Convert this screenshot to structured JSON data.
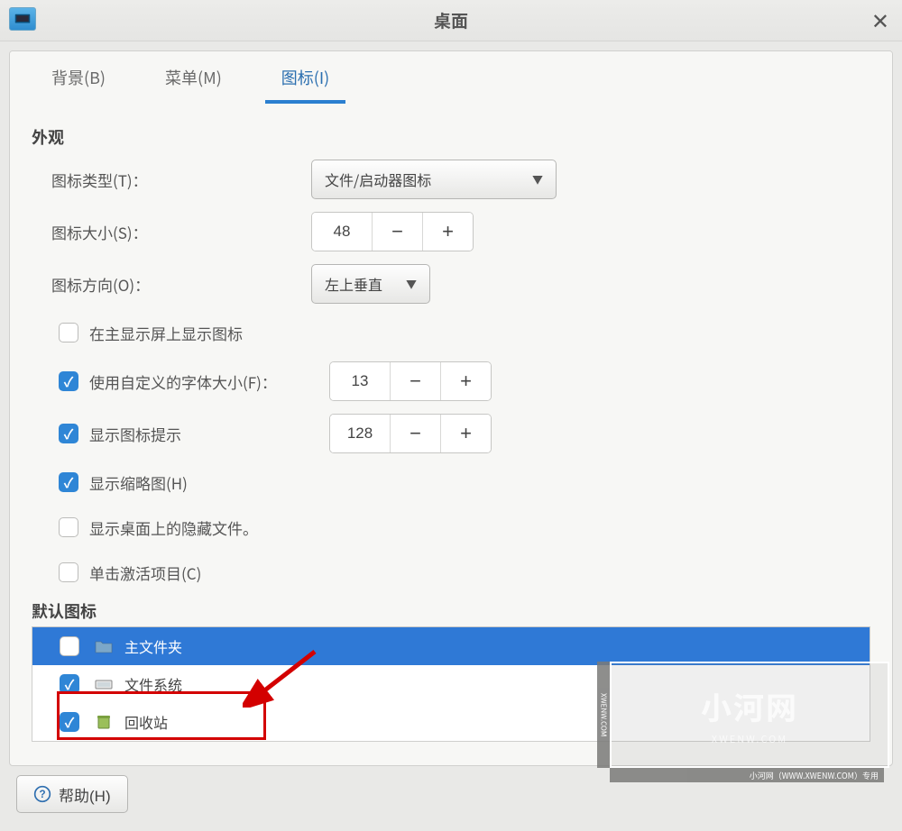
{
  "window": {
    "title": "桌面"
  },
  "tabs": [
    {
      "label": "背景(B)",
      "active": false
    },
    {
      "label": "菜单(M)",
      "active": false
    },
    {
      "label": "图标(I)",
      "active": true
    }
  ],
  "sections": {
    "appearance_title": "外观",
    "default_icons_title": "默认图标"
  },
  "fields": {
    "icon_type": {
      "label": "图标类型(T)：",
      "value": "文件/启动器图标"
    },
    "icon_size": {
      "label": "图标大小(S)：",
      "value": "48"
    },
    "icon_orientation": {
      "label": "图标方向(O)：",
      "value": "左上垂直"
    },
    "show_on_primary": {
      "label": "在主显示屏上显示图标",
      "checked": false
    },
    "custom_font_size": {
      "label": "使用自定义的字体大小(F)：",
      "checked": true,
      "value": "13"
    },
    "show_tooltips": {
      "label": "显示图标提示",
      "checked": true,
      "value": "128"
    },
    "show_thumbnails": {
      "label": "显示缩略图(H)",
      "checked": true
    },
    "show_hidden": {
      "label": "显示桌面上的隐藏文件。",
      "checked": false
    },
    "single_click": {
      "label": "单击激活项目(C)",
      "checked": false
    }
  },
  "default_icons_list": [
    {
      "label": "主文件夹",
      "checked": false,
      "selected": true,
      "icon": "folder-home"
    },
    {
      "label": "文件系统",
      "checked": true,
      "selected": false,
      "icon": "drive"
    },
    {
      "label": "回收站",
      "checked": true,
      "selected": false,
      "icon": "trash"
    }
  ],
  "footer": {
    "help_label": "帮助(H)"
  },
  "watermark": {
    "main": "小河网",
    "sub": "XWENW.COM",
    "side": "XWENW.COM",
    "bottom": "小河网（WWW.XWENW.COM）专用"
  }
}
